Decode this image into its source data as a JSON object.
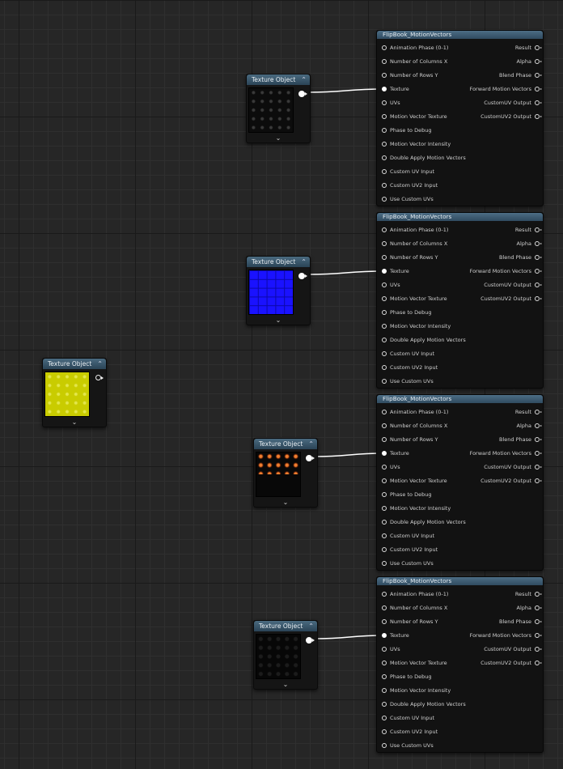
{
  "texture_nodes": [
    {
      "title": "Texture Object",
      "preview": "dark-grid"
    },
    {
      "title": "Texture Object",
      "preview": "blue-grid"
    },
    {
      "title": "Texture Object",
      "preview": "yellow-grid"
    },
    {
      "title": "Texture Object",
      "preview": "fire-flipbook"
    },
    {
      "title": "Texture Object",
      "preview": "black-grid"
    }
  ],
  "flipbook_node": {
    "title": "FlipBook_MotionVectors",
    "inputs": [
      "Animation  Phase (0-1)",
      "Number of Columns X",
      "Number of Rows Y",
      "Texture",
      "UVs",
      "Motion Vector Texture",
      "Phase to Debug",
      "Motion Vector Intensity",
      "Double Apply Motion Vectors",
      "Custom UV Input",
      "Custom UV2 Input",
      "Use Custom UVs"
    ],
    "outputs": [
      "Result",
      "Alpha",
      "Blend Phase",
      "Forward Motion Vectors",
      "CustomUV Output",
      "CustomUV2 Output"
    ]
  },
  "icons": {
    "collapse": "chevron-up-icon",
    "expand": "chevron-down-icon"
  },
  "colors": {
    "graph_bg": "#262626",
    "node_header": "#3b5a70",
    "wire": "#ffffff",
    "preview_blue": "#1a12ff",
    "preview_yellow": "#c9cc00"
  }
}
